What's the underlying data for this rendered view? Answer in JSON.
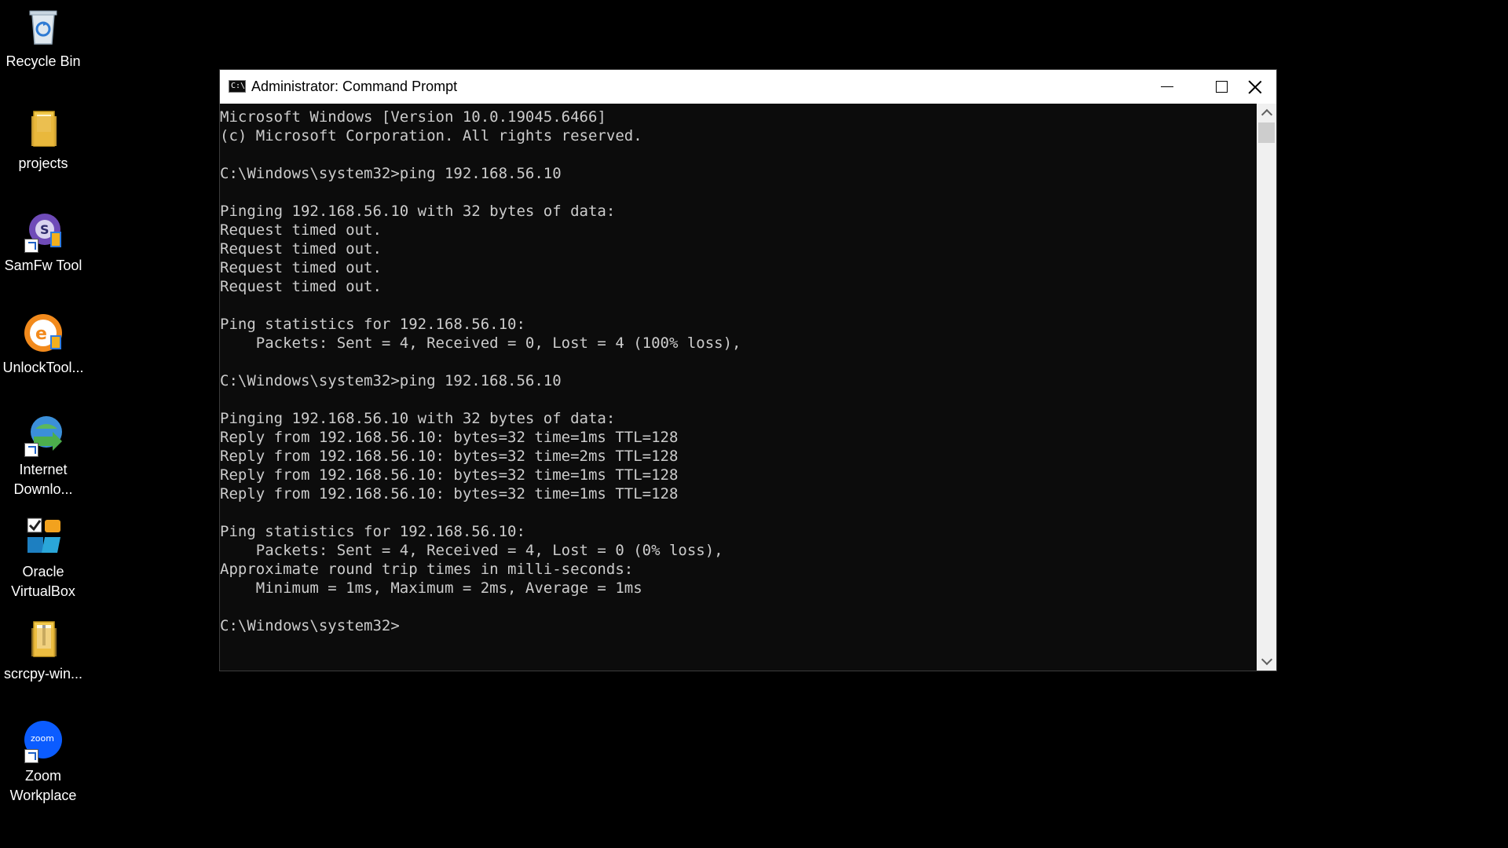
{
  "desktop": {
    "icons": [
      {
        "label": "Recycle Bin",
        "icon": "recycle-bin-icon"
      },
      {
        "label": "projects",
        "icon": "folder-icon"
      },
      {
        "label": "SamFw Tool",
        "icon": "samfw-tool-icon"
      },
      {
        "label": "UnlockTool...",
        "icon": "unlocktool-icon"
      },
      {
        "label": "Internet Downlo...",
        "icon": "internet-download-manager-icon"
      },
      {
        "label": "Oracle VirtualBox",
        "icon": "virtualbox-icon"
      },
      {
        "label": "scrcpy-win...",
        "icon": "folder-zip-icon"
      },
      {
        "label": "Zoom Workplace",
        "icon": "zoom-icon"
      }
    ]
  },
  "window": {
    "title": "Administrator: Command Prompt",
    "icon_label": "C:\\",
    "console_lines": [
      "Microsoft Windows [Version 10.0.19045.6466]",
      "(c) Microsoft Corporation. All rights reserved.",
      "",
      "C:\\Windows\\system32>ping 192.168.56.10",
      "",
      "Pinging 192.168.56.10 with 32 bytes of data:",
      "Request timed out.",
      "Request timed out.",
      "Request timed out.",
      "Request timed out.",
      "",
      "Ping statistics for 192.168.56.10:",
      "    Packets: Sent = 4, Received = 0, Lost = 4 (100% loss),",
      "",
      "C:\\Windows\\system32>ping 192.168.56.10",
      "",
      "Pinging 192.168.56.10 with 32 bytes of data:",
      "Reply from 192.168.56.10: bytes=32 time=1ms TTL=128",
      "Reply from 192.168.56.10: bytes=32 time=2ms TTL=128",
      "Reply from 192.168.56.10: bytes=32 time=1ms TTL=128",
      "Reply from 192.168.56.10: bytes=32 time=1ms TTL=128",
      "",
      "Ping statistics for 192.168.56.10:",
      "    Packets: Sent = 4, Received = 4, Lost = 0 (0% loss),",
      "Approximate round trip times in milli-seconds:",
      "    Minimum = 1ms, Maximum = 2ms, Average = 1ms",
      "",
      "C:\\Windows\\system32>"
    ]
  },
  "colors": {
    "desktop_bg": "#000000",
    "console_bg": "#0c0c0c",
    "console_fg": "#cccccc",
    "titlebar_bg": "#ffffff"
  }
}
